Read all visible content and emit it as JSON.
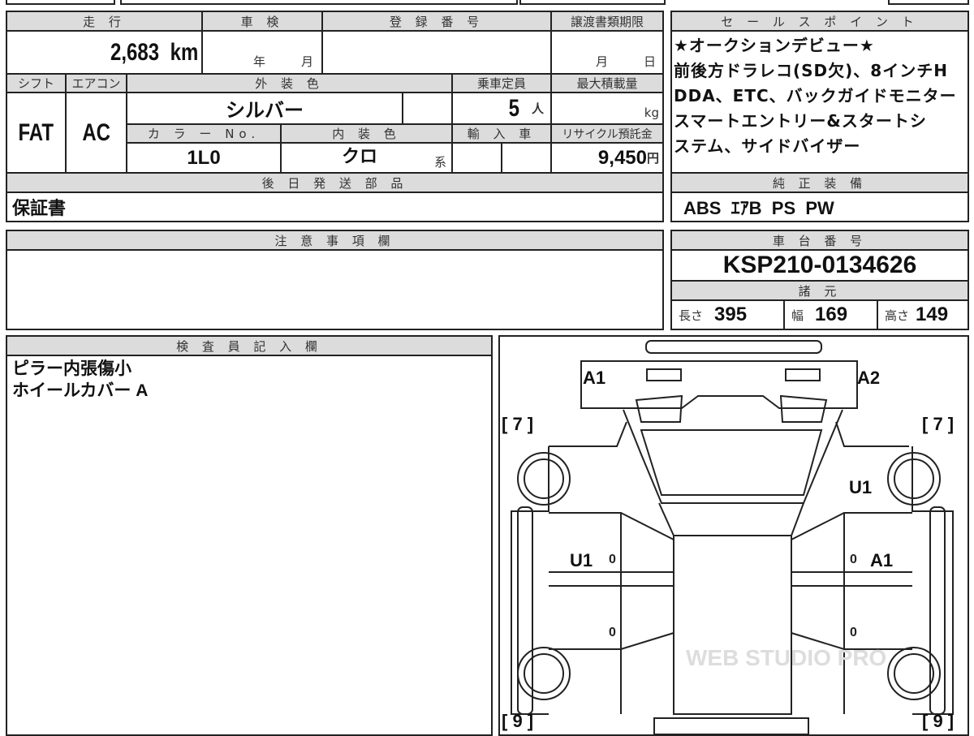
{
  "mileage": {
    "label": "走 行",
    "value": "2,683",
    "unit": "km"
  },
  "inspection": {
    "label": "車 検",
    "year": "年",
    "month": "月"
  },
  "registration": {
    "label": "登 録 番 号",
    "value": ""
  },
  "transfer_deadline": {
    "label": "譲渡書類期限",
    "month": "月",
    "day": "日"
  },
  "shift": {
    "label": "シフト",
    "value": "FAT"
  },
  "aircon": {
    "label": "エアコン",
    "value": "AC"
  },
  "exterior_color": {
    "label": "外 装 色",
    "value": "シルバー"
  },
  "capacity": {
    "label": "乗車定員",
    "value": "5",
    "unit": "人"
  },
  "max_load": {
    "label": "最大積載量",
    "unit": "kg"
  },
  "color_no": {
    "label": "カ ラ ー No.",
    "value": "1L0"
  },
  "interior_color": {
    "label": "内 装 色",
    "value": "クロ",
    "suffix": "系"
  },
  "import": {
    "label": "輸 入 車"
  },
  "recycle": {
    "label": "リサイクル預託金",
    "value": "9,450",
    "unit": "円"
  },
  "later_parts": {
    "label": "後 日 発 送 部 品",
    "value": "保証書"
  },
  "notes": {
    "label": "注 意 事 項 欄"
  },
  "sales_points": {
    "label": "セ ー ル ス ポ イ ン ト",
    "lines": [
      "★オークションデビュー★",
      "前後方ドラレコ(SD欠)、8インチH",
      "DDA、ETC、バックガイドモニター",
      "スマートエントリー&スタートシ",
      "ステム、サイドバイザー"
    ]
  },
  "genuine_equipment": {
    "label": "純 正 装 備",
    "value": "ABS  ｴｱB  PS  PW"
  },
  "chassis": {
    "label": "車 台 番 号",
    "value": "KSP210-0134626"
  },
  "specs": {
    "label": "諸 元",
    "length_label": "長さ",
    "length": "395",
    "width_label": "幅",
    "width": "169",
    "height_label": "高さ",
    "height": "149"
  },
  "inspector": {
    "label": "検 査 員 記 入 欄",
    "lines": [
      "ピラー内張傷小",
      "ホイールカバー A"
    ]
  },
  "diagram": {
    "a1_front": "A1",
    "a2_front": "A2",
    "left_front_bracket": "[ 7 ]",
    "right_front_bracket": "[ 7 ]",
    "u1_right_front": "U1",
    "u1_left_door": "U1",
    "a1_right_door": "A1",
    "zero": "0",
    "left_rear_bracket": "[ 9 ]",
    "right_rear_bracket": "[ 9 ]",
    "watermark": "WEB STUDIO PRO"
  }
}
